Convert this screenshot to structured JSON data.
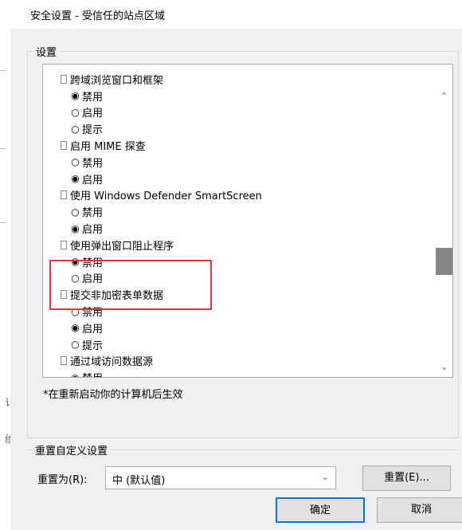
{
  "window": {
    "title": "安全设置 - 受信任的站点区域"
  },
  "settings_group": {
    "legend": "设置",
    "items": [
      {
        "type": "cat",
        "label": "跨域浏览窗口和框架"
      },
      {
        "type": "opt",
        "radio": "◉",
        "label": "禁用"
      },
      {
        "type": "opt",
        "radio": "○",
        "label": "启用"
      },
      {
        "type": "opt",
        "radio": "○",
        "label": "提示"
      },
      {
        "type": "cat",
        "label": "启用 MIME 探查"
      },
      {
        "type": "opt",
        "radio": "○",
        "label": "禁用"
      },
      {
        "type": "opt",
        "radio": "◉",
        "label": "启用"
      },
      {
        "type": "cat",
        "label": "使用 Windows Defender SmartScreen"
      },
      {
        "type": "opt",
        "radio": "○",
        "label": "禁用"
      },
      {
        "type": "opt",
        "radio": "◉",
        "label": "启用"
      },
      {
        "type": "cat",
        "label": "使用弹出窗口阻止程序"
      },
      {
        "type": "opt",
        "radio": "◉",
        "label": "禁用"
      },
      {
        "type": "opt",
        "radio": "○",
        "label": "启用"
      },
      {
        "type": "cat",
        "label": "提交非加密表单数据"
      },
      {
        "type": "opt",
        "radio": "○",
        "label": "禁用"
      },
      {
        "type": "opt",
        "radio": "◉",
        "label": "启用"
      },
      {
        "type": "opt",
        "radio": "○",
        "label": "提示"
      },
      {
        "type": "cat",
        "label": "通过域访问数据源"
      },
      {
        "type": "opt",
        "radio": "◉",
        "label": "禁用"
      }
    ],
    "note": "*在重新启动你的计算机后生效"
  },
  "reset_group": {
    "legend": "重置自定义设置",
    "reset_to_label": "重置为(R):",
    "select_value": "中 (默认值)",
    "reset_button": "重置(E)..."
  },
  "buttons": {
    "ok": "确定",
    "cancel": "取消"
  },
  "left_edge_marks": [
    "讠",
    "绐"
  ],
  "colors": {
    "highlight_border": "#e03838",
    "focus_border": "#0078d7",
    "dialog_bg": "#f0f0f0"
  }
}
